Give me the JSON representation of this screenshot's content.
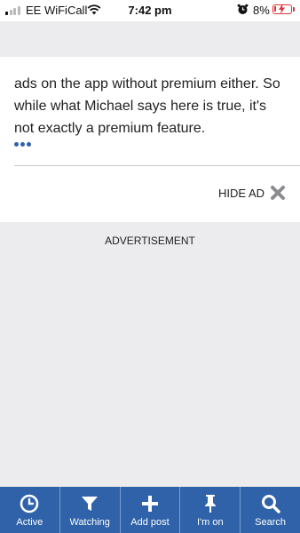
{
  "status_bar": {
    "carrier": "EE WiFiCall",
    "time": "7:42 pm",
    "battery": "8%"
  },
  "post": {
    "text": "ads on the app without premium either. So while what Michael says here is true, it's not exactly a premium feature.",
    "hide_ad_label": "HIDE AD"
  },
  "advertisement_label": "ADVERTISEMENT",
  "tab_bar": {
    "tabs": [
      {
        "label": "Active",
        "icon": "clock-icon"
      },
      {
        "label": "Watching",
        "icon": "filter-icon"
      },
      {
        "label": "Add post",
        "icon": "plus-icon"
      },
      {
        "label": "I'm on",
        "icon": "pin-icon"
      },
      {
        "label": "Search",
        "icon": "search-icon"
      }
    ]
  },
  "colors": {
    "accent": "#2f62a8",
    "battery_low": "#e0333a",
    "background": "#ececee"
  }
}
